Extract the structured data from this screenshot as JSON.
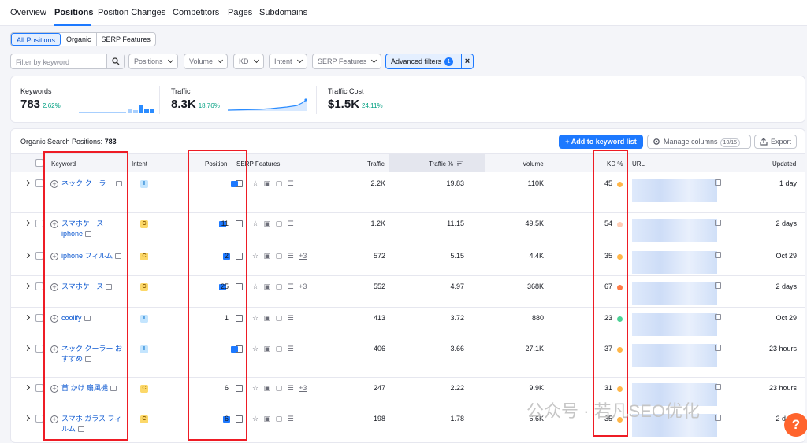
{
  "nav": {
    "tabs": [
      "Overview",
      "Positions",
      "Position Changes",
      "Competitors",
      "Pages",
      "Subdomains"
    ],
    "active_tab": "Positions"
  },
  "segment": {
    "buttons": [
      "All Positions",
      "Organic",
      "SERP Features"
    ],
    "active": "All Positions"
  },
  "filters": {
    "search_placeholder": "Filter by keyword",
    "dropdowns": [
      "Positions",
      "Volume",
      "KD",
      "Intent",
      "SERP Features"
    ],
    "advanced_label": "Advanced filters",
    "advanced_count": "1"
  },
  "summary": {
    "keywords": {
      "label": "Keywords",
      "value": "783",
      "change": "2.62%"
    },
    "traffic": {
      "label": "Traffic",
      "value": "8.3K",
      "change": "18.76%"
    },
    "traffic_cost": {
      "label": "Traffic Cost",
      "value": "$1.5K",
      "change": "24.11%"
    }
  },
  "table": {
    "title_prefix": "Organic Search Positions:",
    "title_count": "783",
    "add_button": "+ Add to keyword list",
    "manage_button": "Manage columns",
    "manage_count": "10/15",
    "export_button": "Export",
    "headers": {
      "keyword": "Keyword",
      "intent": "Intent",
      "position": "Position",
      "serp": "SERP Features",
      "traffic": "Traffic",
      "traffic_pct": "Traffic %",
      "volume": "Volume",
      "kd": "KD %",
      "url": "URL",
      "updated": "Updated"
    },
    "rows": [
      {
        "keyword": "ネック クーラー",
        "intent": "I",
        "position": "",
        "serp_more": "",
        "traffic": "2.2K",
        "traffic_pct": "19.83",
        "volume": "110K",
        "kd": "45",
        "kd_color": "#ffb648",
        "updated": "1 day"
      },
      {
        "keyword": "スマホケース iphone",
        "intent": "C",
        "position": "11",
        "serp_more": "",
        "traffic": "1.2K",
        "traffic_pct": "11.15",
        "volume": "49.5K",
        "kd": "54",
        "kd_color": "#ffcdb5",
        "updated": "2 days"
      },
      {
        "keyword": "iphone フィルム",
        "intent": "C",
        "position": "2",
        "serp_more": "+3",
        "traffic": "572",
        "traffic_pct": "5.15",
        "volume": "4.4K",
        "kd": "35",
        "kd_color": "#ffb648",
        "updated": "Oct 29"
      },
      {
        "keyword": "スマホケース",
        "intent": "C",
        "position": "25",
        "serp_more": "+3",
        "traffic": "552",
        "traffic_pct": "4.97",
        "volume": "368K",
        "kd": "67",
        "kd_color": "#ff7a45",
        "updated": "2 days"
      },
      {
        "keyword": "coolify",
        "intent": "I",
        "position": "1",
        "serp_more": "",
        "traffic": "413",
        "traffic_pct": "3.72",
        "volume": "880",
        "kd": "23",
        "kd_color": "#4cd195",
        "updated": "Oct 29"
      },
      {
        "keyword": "ネック クーラー おすすめ",
        "intent": "I",
        "position": "",
        "serp_more": "",
        "traffic": "406",
        "traffic_pct": "3.66",
        "volume": "27.1K",
        "kd": "37",
        "kd_color": "#ffb648",
        "updated": "23 hours"
      },
      {
        "keyword": "首 かけ 扇風機",
        "intent": "C",
        "position": "6",
        "serp_more": "+3",
        "traffic": "247",
        "traffic_pct": "2.22",
        "volume": "9.9K",
        "kd": "31",
        "kd_color": "#ffb648",
        "updated": "23 hours"
      },
      {
        "keyword": "スマホ ガラス フィルム",
        "intent": "C",
        "position": "6",
        "serp_more": "",
        "traffic": "198",
        "traffic_pct": "1.78",
        "volume": "6.6K",
        "kd": "35",
        "kd_color": "#ffb648",
        "updated": "2 days"
      }
    ]
  },
  "watermark": "公众号 · 若凡SEO优化",
  "help_label": "?"
}
